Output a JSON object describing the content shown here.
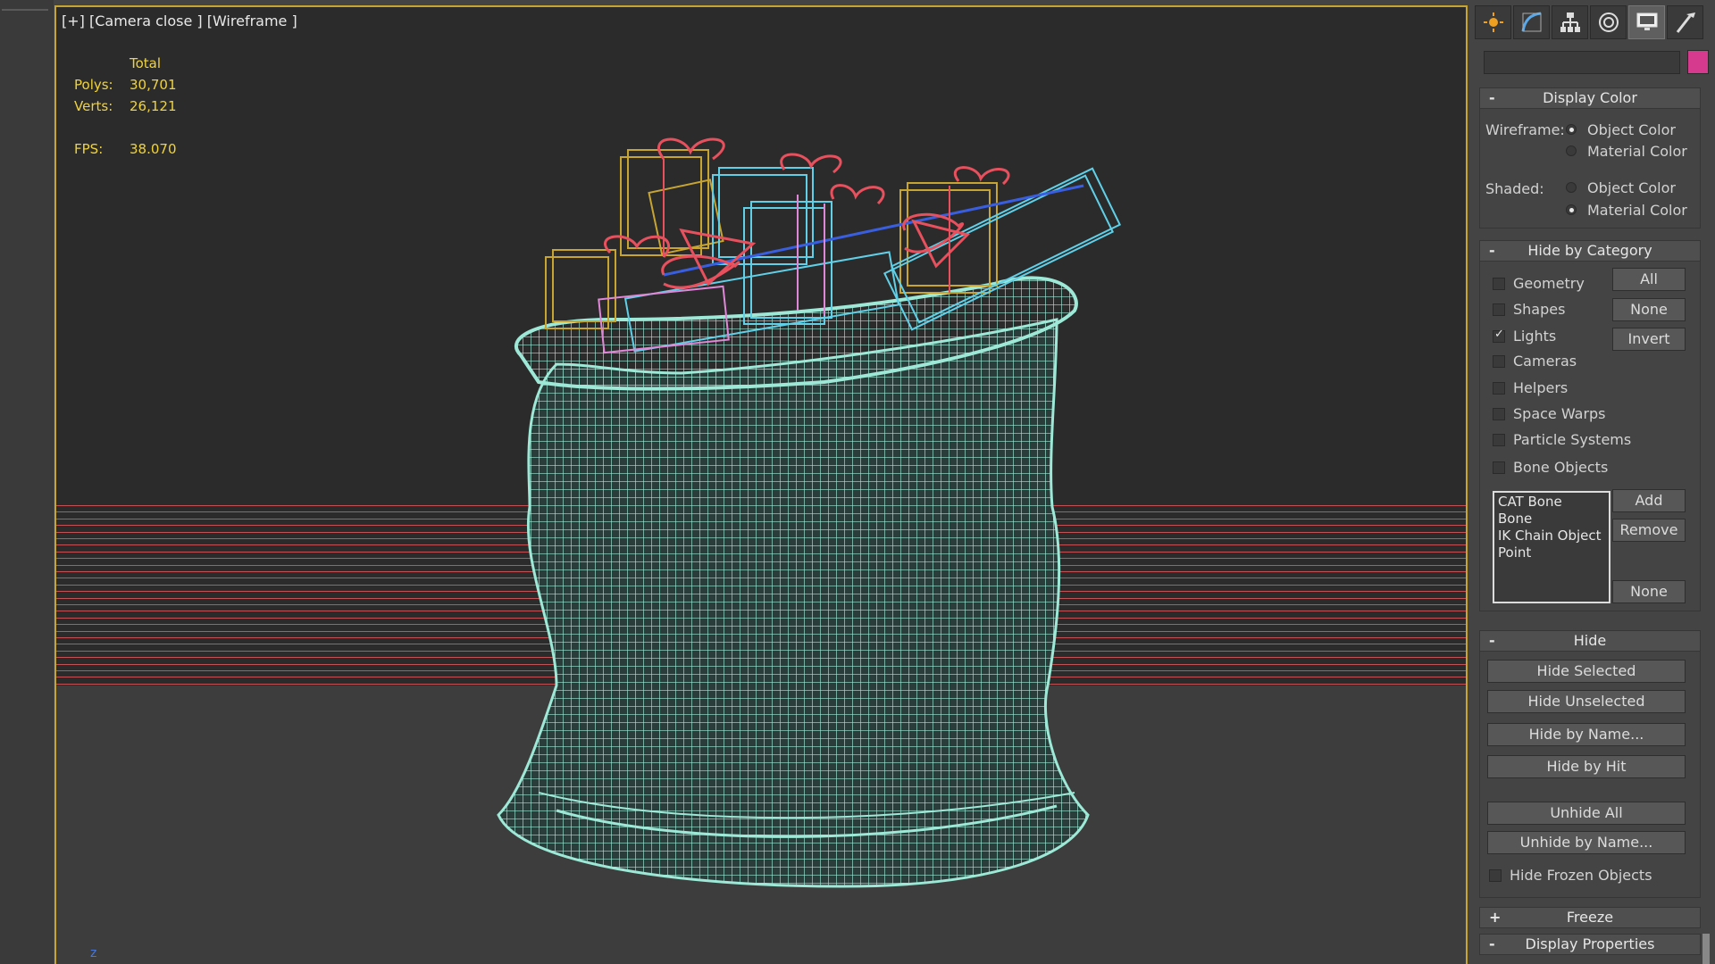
{
  "viewport": {
    "label": "[+] [Camera close ] [Wireframe ]",
    "stats": {
      "total_header": "Total",
      "polys_label": "Polys:",
      "polys_value": "30,701",
      "verts_label": "Verts:",
      "verts_value": "26,121",
      "fps_label": "FPS:",
      "fps_value": "38.070"
    },
    "axis_label": "z"
  },
  "colors": {
    "viewport_border": "#c8a431",
    "wire_sack": "#9de8d6",
    "wire_ribbon": "#e8505e",
    "wire_box_cyan": "#5fd0e8",
    "wire_box_gold": "#c8a431",
    "wire_pink": "#e088d8",
    "stats_text": "#f0d33c",
    "object_swatch": "#d63a8f"
  },
  "panel": {
    "tabs": [
      {
        "icon": "create-sun-icon"
      },
      {
        "icon": "modify-curve-icon"
      },
      {
        "icon": "hierarchy-icon"
      },
      {
        "icon": "motion-ring-icon"
      },
      {
        "icon": "display-monitor-icon"
      },
      {
        "icon": "utilities-hammer-icon"
      }
    ],
    "display_color": {
      "title": "Display Color",
      "sign": "-",
      "wireframe_label": "Wireframe:",
      "shaded_label": "Shaded:",
      "object_color": "Object Color",
      "material_color": "Material Color"
    },
    "hide_by_category": {
      "title": "Hide by Category",
      "sign": "-",
      "items": [
        {
          "label": "Geometry",
          "checked": false
        },
        {
          "label": "Shapes",
          "checked": false
        },
        {
          "label": "Lights",
          "checked": true
        },
        {
          "label": "Cameras",
          "checked": false
        },
        {
          "label": "Helpers",
          "checked": false
        },
        {
          "label": "Space Warps",
          "checked": false
        },
        {
          "label": "Particle Systems",
          "checked": false
        },
        {
          "label": "Bone Objects",
          "checked": false
        }
      ],
      "all_button": "All",
      "none_button": "None",
      "invert_button": "Invert",
      "list_items": [
        "CAT Bone",
        "Bone",
        "IK Chain Object",
        "Point"
      ],
      "add_button": "Add",
      "remove_button": "Remove",
      "list_none_button": "None"
    },
    "hide": {
      "title": "Hide",
      "sign": "-",
      "hide_selected": "Hide Selected",
      "hide_unselected": "Hide Unselected",
      "hide_by_name": "Hide by Name...",
      "hide_by_hit": "Hide by Hit",
      "unhide_all": "Unhide All",
      "unhide_by_name": "Unhide by Name...",
      "hide_frozen": "Hide Frozen Objects"
    },
    "freeze": {
      "title": "Freeze",
      "sign": "+"
    },
    "display_properties": {
      "title": "Display Properties",
      "sign": "-"
    }
  }
}
